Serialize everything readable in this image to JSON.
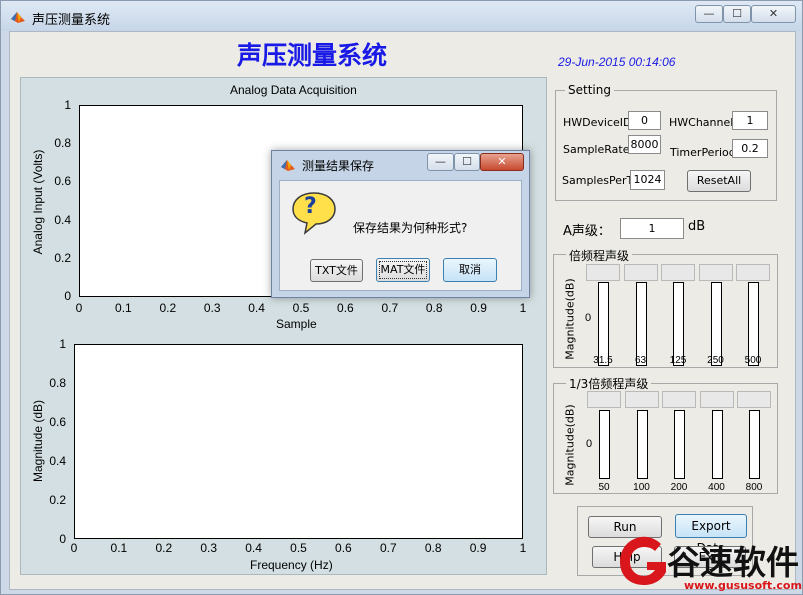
{
  "window": {
    "title": "声压测量系统",
    "min_glyph": "—",
    "max_glyph": "☐",
    "close_glyph": "✕"
  },
  "app": {
    "heading": "声压测量系统",
    "datetime": "29-Jun-2015 00:14:06"
  },
  "plot1": {
    "title": "Analog Data Acquisition",
    "xlabel": "Sample",
    "ylabel": "Analog Input (Volts)",
    "yticks": [
      "1",
      "0.8",
      "0.6",
      "0.4",
      "0.2",
      "0"
    ],
    "xticks": [
      "0",
      "0.1",
      "0.2",
      "0.3",
      "0.4",
      "0.5",
      "0.6",
      "0.7",
      "0.8",
      "0.9",
      "1"
    ]
  },
  "plot2": {
    "xlabel": "Frequency (Hz)",
    "ylabel": "Magnitude (dB)",
    "yticks": [
      "1",
      "0.8",
      "0.6",
      "0.4",
      "0.2",
      "0"
    ],
    "xticks": [
      "0",
      "0.1",
      "0.2",
      "0.3",
      "0.4",
      "0.5",
      "0.6",
      "0.7",
      "0.8",
      "0.9",
      "1"
    ]
  },
  "setting": {
    "title": "Setting",
    "hw_device_label": "HWDeviceID",
    "hw_device_value": "0",
    "hw_channel_label": "HWChannel",
    "hw_channel_value": "1",
    "sample_rate_label": "SampleRate",
    "sample_rate_value": "8000",
    "timer_period_label": "TimerPeriod",
    "timer_period_value": "0.2",
    "samples_per_label": "SamplesPerT",
    "samples_per_value": "1024",
    "reset_label": "ResetAll"
  },
  "a_level": {
    "label": "A声级：",
    "value": "1",
    "unit": "dB"
  },
  "octave": {
    "title": "倍频程声级",
    "ylabel": "Magnitude(dB)",
    "zero_label": "0",
    "bands": [
      "31.5",
      "63",
      "125",
      "250",
      "500"
    ]
  },
  "third_octave": {
    "title": "1/3倍频程声级",
    "ylabel": "Magnitude(dB)",
    "zero_label": "0",
    "bands": [
      "50",
      "100",
      "200",
      "400",
      "800"
    ]
  },
  "actions": {
    "run_label": "Run",
    "export_label": "Export Data",
    "help_label": "Help",
    "exit_label": "Exit"
  },
  "dialog": {
    "title": "测量结果保存",
    "icon_glyph": "?",
    "question": "保存结果为何种形式?",
    "txt_label": "TXT文件",
    "mat_label": "MAT文件",
    "cancel_label": "取消"
  },
  "watermark": {
    "brand": "谷速软件",
    "url": "www.gususoft.com"
  },
  "colors": {
    "heading": "#1a1ae6",
    "datetime": "#1a1ae6",
    "plot_panel": "#d3dfe2",
    "brand_red": "#d8161b"
  }
}
